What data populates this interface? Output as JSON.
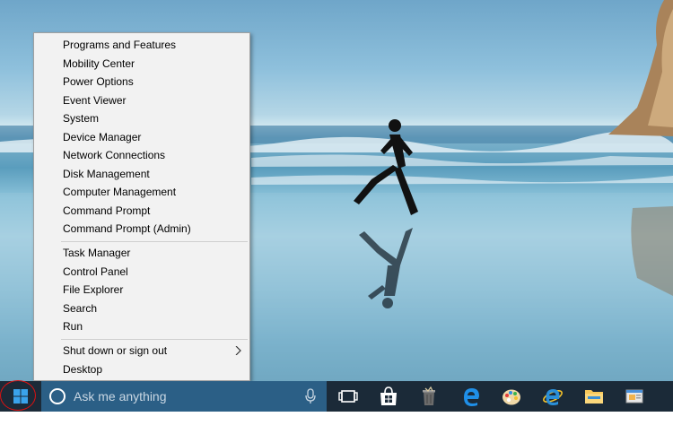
{
  "menu": {
    "group1": [
      {
        "label": "Programs and Features"
      },
      {
        "label": "Mobility Center"
      },
      {
        "label": "Power Options"
      },
      {
        "label": "Event Viewer"
      },
      {
        "label": "System"
      },
      {
        "label": "Device Manager"
      },
      {
        "label": "Network Connections"
      },
      {
        "label": "Disk Management"
      },
      {
        "label": "Computer Management"
      },
      {
        "label": "Command Prompt"
      },
      {
        "label": "Command Prompt (Admin)"
      }
    ],
    "group2": [
      {
        "label": "Task Manager"
      },
      {
        "label": "Control Panel"
      },
      {
        "label": "File Explorer"
      },
      {
        "label": "Search"
      },
      {
        "label": "Run"
      }
    ],
    "group3": [
      {
        "label": "Shut down or sign out"
      },
      {
        "label": "Desktop"
      }
    ]
  },
  "taskbar": {
    "search_placeholder": "Ask me anything",
    "icons": [
      "task-view-icon",
      "store-icon",
      "recycle-bin-icon",
      "edge-icon",
      "paint-icon",
      "internet-explorer-icon",
      "file-explorer-icon",
      "mail-icon"
    ]
  },
  "colors": {
    "taskbar": "#1b2a38",
    "search_box": "#2b5f86",
    "menu_bg": "#f2f2f2",
    "highlight_circle": "#d11111"
  }
}
